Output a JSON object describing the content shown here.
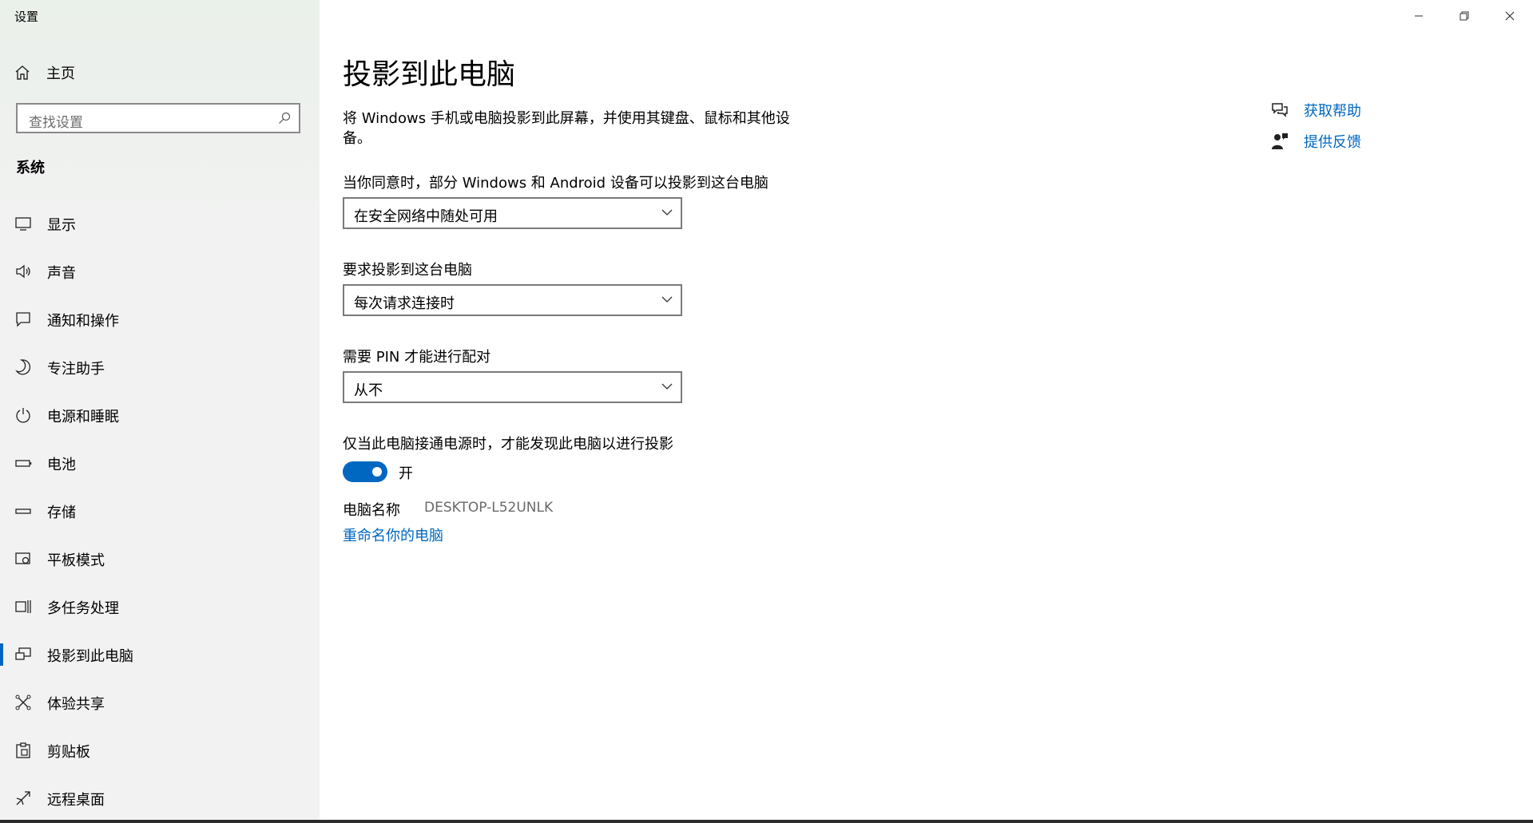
{
  "window": {
    "title": "设置"
  },
  "sidebar": {
    "home_label": "主页",
    "search_placeholder": "查找设置",
    "section_title": "系统",
    "items": [
      {
        "label": "显示",
        "icon": "monitor-icon"
      },
      {
        "label": "声音",
        "icon": "speaker-icon"
      },
      {
        "label": "通知和操作",
        "icon": "notification-icon"
      },
      {
        "label": "专注助手",
        "icon": "moon-icon"
      },
      {
        "label": "电源和睡眠",
        "icon": "power-icon"
      },
      {
        "label": "电池",
        "icon": "battery-icon"
      },
      {
        "label": "存储",
        "icon": "storage-icon"
      },
      {
        "label": "平板模式",
        "icon": "tablet-mode-icon"
      },
      {
        "label": "多任务处理",
        "icon": "multitasking-icon"
      },
      {
        "label": "投影到此电脑",
        "icon": "project-icon",
        "selected": true
      },
      {
        "label": "体验共享",
        "icon": "shared-experiences-icon"
      },
      {
        "label": "剪贴板",
        "icon": "clipboard-icon"
      },
      {
        "label": "远程桌面",
        "icon": "remote-desktop-icon"
      }
    ]
  },
  "main": {
    "title": "投影到此电脑",
    "description": "将 Windows 手机或电脑投影到此屏幕，并使用其键盘、鼠标和其他设备。",
    "availability": {
      "label": "当你同意时，部分 Windows 和 Android 设备可以投影到这台电脑",
      "value": "在安全网络中随处可用"
    },
    "ask_to_project": {
      "label": "要求投影到这台电脑",
      "value": "每次请求连接时"
    },
    "require_pin": {
      "label": "需要 PIN 才能进行配对",
      "value": "从不"
    },
    "power_discovery": {
      "label": "仅当此电脑接通电源时，才能发现此电脑以进行投影",
      "state_text": "开",
      "on": true
    },
    "pc_name": {
      "label": "电脑名称",
      "value": "DESKTOP-L52UNLK"
    },
    "rename_link": "重命名你的电脑"
  },
  "help": {
    "get_help": "获取帮助",
    "give_feedback": "提供反馈"
  },
  "colors": {
    "accent": "#0067c0",
    "sidebar_bg": "#f2f2f2"
  }
}
